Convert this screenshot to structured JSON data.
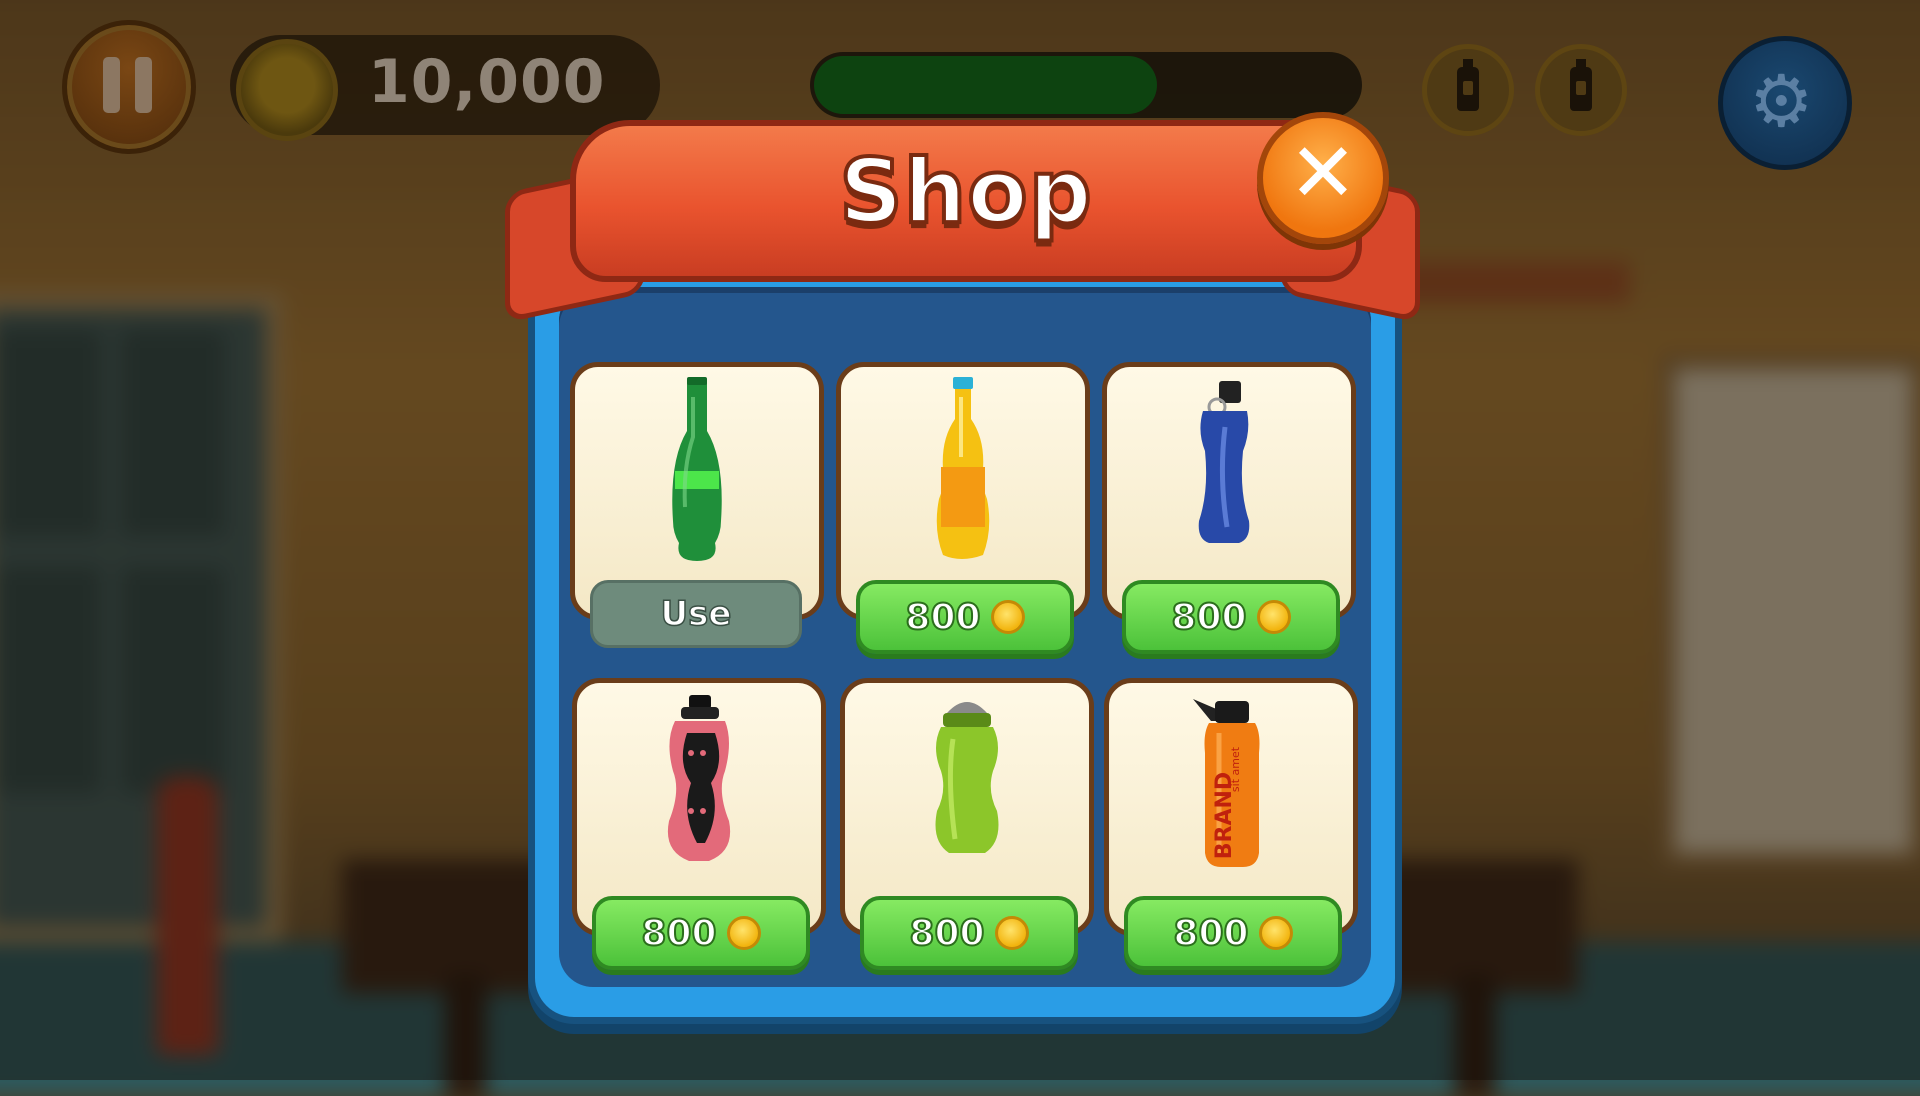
{
  "hud": {
    "coins": "10,000",
    "progress_fraction": 0.63,
    "icons": [
      "pause-icon",
      "coin-icon",
      "bottle-icon",
      "bottle-icon",
      "gear-icon"
    ]
  },
  "shop": {
    "title": "Shop",
    "close_icon": "close-icon",
    "items": [
      {
        "bottle": "green-glass-bottle",
        "action": "Use",
        "owned": true
      },
      {
        "bottle": "yellow-soda-bottle",
        "price": "800",
        "owned": false
      },
      {
        "bottle": "blue-aluminum-bottle",
        "price": "800",
        "owned": false
      },
      {
        "bottle": "pink-sport-bottle",
        "price": "800",
        "owned": false
      },
      {
        "bottle": "green-sport-bottle",
        "price": "800",
        "owned": false
      },
      {
        "bottle": "orange-brand-bottle",
        "price": "800",
        "owned": false,
        "label": "BRAND",
        "sublabel": "sit amet"
      }
    ]
  },
  "colors": {
    "ribbon": "#e9532e",
    "panel": "#2a9de6",
    "price_button": "#5bd145",
    "close_button": "#f0760f"
  }
}
